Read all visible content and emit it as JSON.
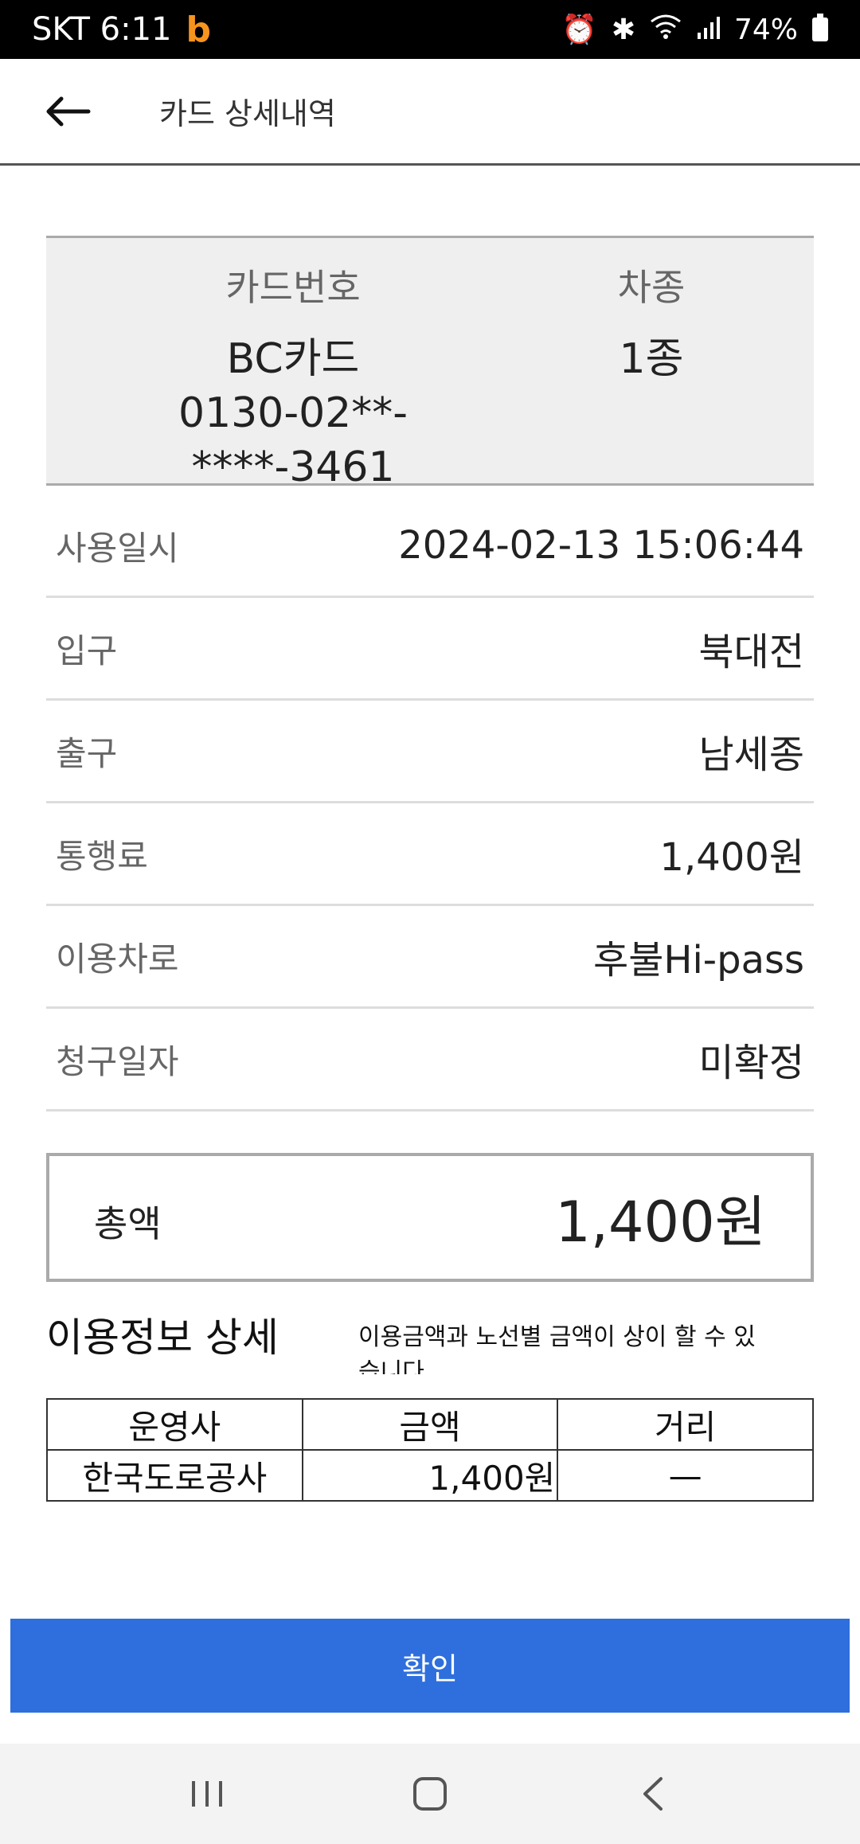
{
  "status_bar": {
    "carrier_time": "SKT 6:11",
    "app_badge": "b",
    "battery": "74%"
  },
  "header": {
    "title": "카드 상세내역",
    "back_icon": "arrow-left-icon"
  },
  "card_summary": {
    "card_number_label": "카드번호",
    "card_issuer": "BC카드",
    "card_number": "0130-02**-****-3461",
    "vehicle_type_label": "차종",
    "vehicle_type": "1종"
  },
  "details": [
    {
      "label": "사용일시",
      "value": "2024-02-13 15:06:44"
    },
    {
      "label": "입구",
      "value": "북대전"
    },
    {
      "label": "출구",
      "value": "남세종"
    },
    {
      "label": "통행료",
      "value": "1,400원"
    },
    {
      "label": "이용차로",
      "value": "후불Hi-pass"
    },
    {
      "label": "청구일자",
      "value": "미확정"
    }
  ],
  "total": {
    "label": "총액",
    "value": "1,400원"
  },
  "usage_detail": {
    "title": "이용정보 상세",
    "note": "이용금액과 노선별 금액이 상이 할 수 있습니다",
    "columns": [
      "운영사",
      "금액",
      "거리"
    ],
    "rows": [
      [
        "한국도로공사",
        "1,400원",
        "—"
      ]
    ]
  },
  "confirm_label": "확인",
  "nav": {
    "recents_icon": "recent-apps-icon",
    "home_icon": "home-icon",
    "back_icon": "back-chevron-icon"
  },
  "colors": {
    "accent": "#2e6fdd",
    "status_bar": "#000000",
    "badge": "#f7941d"
  }
}
